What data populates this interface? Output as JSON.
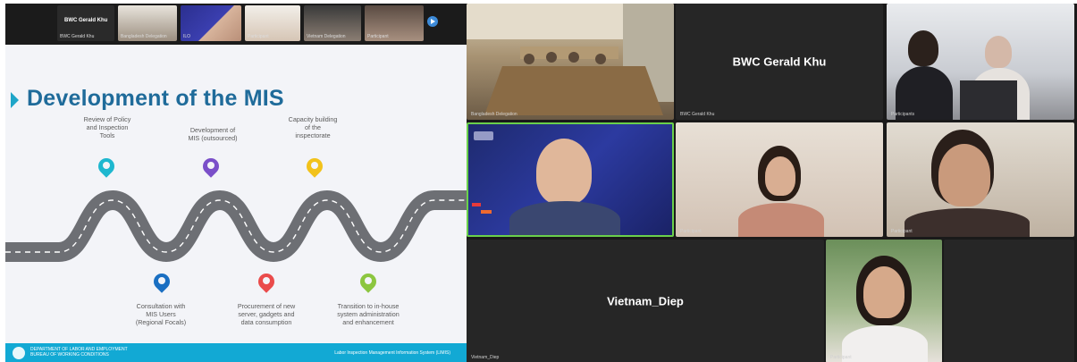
{
  "presentation": {
    "thumbnail_strip": {
      "tiles": [
        {
          "name": "BWC Gerald Khu",
          "label": "BWC Gerald Khu"
        },
        {
          "name": "",
          "label": "Bangladesh Delegation"
        },
        {
          "name": "",
          "label": "ILO"
        },
        {
          "name": "",
          "label": "Participant"
        },
        {
          "name": "",
          "label": "Vietnam Delegation"
        },
        {
          "name": "",
          "label": "Participant"
        }
      ]
    },
    "slide": {
      "title": "Development of the MIS",
      "steps_top": [
        {
          "text": "Review of Policy\nand Inspection\nTools",
          "pin_color": "#1eb7cf"
        },
        {
          "text": "Development of\nMIS (outsourced)",
          "pin_color": "#7a4fc9"
        },
        {
          "text": "Capacity building\nof the\ninspectorate",
          "pin_color": "#f2c21b"
        }
      ],
      "steps_bottom": [
        {
          "text": "Consultation with\nMIS Users\n(Regional Focals)",
          "pin_color": "#1a6fc2"
        },
        {
          "text": "Procurement of new\nserver, gadgets and\ndata consumption",
          "pin_color": "#ea4b4b"
        },
        {
          "text": "Transition to in-house\nsystem administration\nand enhancement",
          "pin_color": "#8cc63f"
        }
      ],
      "footer_left": "DEPARTMENT OF LABOR AND EMPLOYMENT\nBUREAU OF WORKING CONDITIONS",
      "footer_right": "Labor Inspection Management Information System (LIMIS)"
    }
  },
  "gallery": {
    "tiles": [
      {
        "id": "room",
        "label": "Bangladesh Delegation",
        "center_name": ""
      },
      {
        "id": "gerald",
        "label": "BWC Gerald Khu",
        "center_name": "BWC Gerald Khu"
      },
      {
        "id": "two-people",
        "label": "Participants",
        "center_name": ""
      },
      {
        "id": "ilo-speaker",
        "label": "",
        "center_name": ""
      },
      {
        "id": "young-woman",
        "label": "Participant",
        "center_name": ""
      },
      {
        "id": "older-woman",
        "label": "Participant",
        "center_name": ""
      },
      {
        "id": "vietnam-diep",
        "label": "Vietnam_Diep",
        "center_name": "Vietnam_Diep"
      },
      {
        "id": "woman-outdoor",
        "label": "Participant",
        "center_name": ""
      }
    ]
  },
  "colors": {
    "title_blue": "#1f6b9a",
    "footer_cyan": "#12a9d4",
    "active_speaker_border": "#6ad04b",
    "road": "#6d6f74"
  }
}
